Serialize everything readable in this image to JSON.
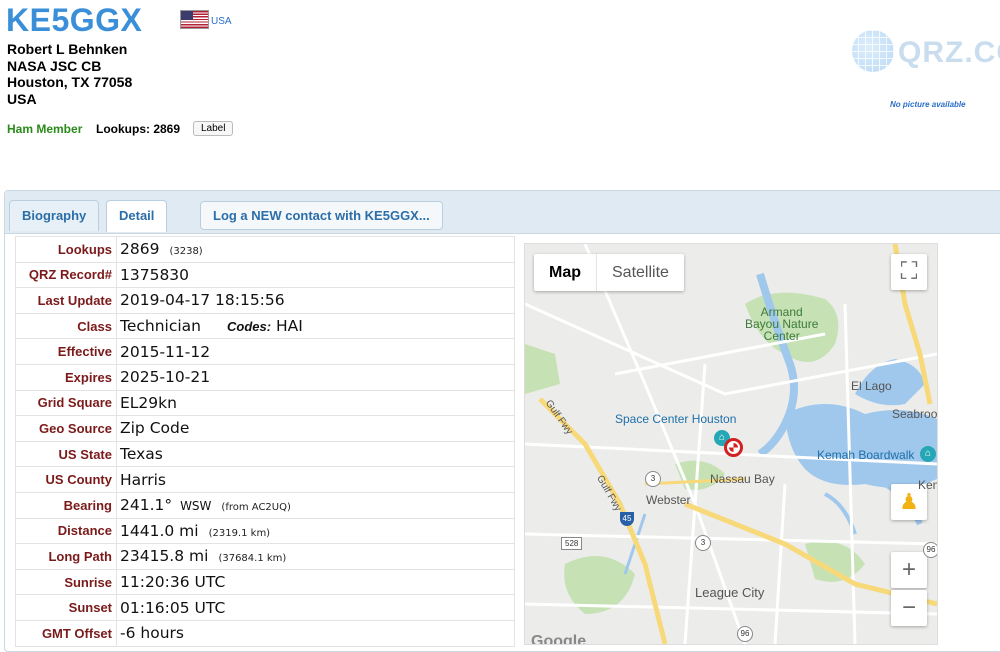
{
  "header": {
    "callsign": "KE5GGX",
    "country_label": "USA",
    "address": {
      "name": "Robert L Behnken",
      "line2": "NASA JSC CB",
      "line3": "Houston, TX 77058",
      "line4": "USA"
    },
    "member_status": "Ham Member",
    "lookups_text": "Lookups: 2869",
    "label_button": "Label",
    "logo_text": "QRZ.COM",
    "no_picture": "No picture available"
  },
  "tabs": {
    "biography": "Biography",
    "detail": "Detail",
    "log_contact": "Log a NEW contact with KE5GGX..."
  },
  "detail": {
    "lookups": {
      "key": "Lookups",
      "value": "2869",
      "extra": "(3238)"
    },
    "record": {
      "key": "QRZ Record#",
      "value": "1375830"
    },
    "last_update": {
      "key": "Last Update",
      "value": "2019-04-17 18:15:56"
    },
    "class": {
      "key": "Class",
      "value": "Technician",
      "codes_label": "Codes:",
      "codes": "HAI"
    },
    "effective": {
      "key": "Effective",
      "value": "2015-11-12"
    },
    "expires": {
      "key": "Expires",
      "value": "2025-10-21"
    },
    "grid": {
      "key": "Grid Square",
      "value": "EL29kn"
    },
    "geo": {
      "key": "Geo Source",
      "value": "Zip Code"
    },
    "state": {
      "key": "US State",
      "value": "Texas"
    },
    "county": {
      "key": "US County",
      "value": "Harris"
    },
    "bearing": {
      "key": "Bearing",
      "value": "241.1°",
      "dir": "WSW",
      "extra": "(from AC2UQ)"
    },
    "distance": {
      "key": "Distance",
      "value": "1441.0 mi",
      "extra": "(2319.1 km)"
    },
    "long_path": {
      "key": "Long Path",
      "value": "23415.8 mi",
      "extra": "(37684.1 km)"
    },
    "sunrise": {
      "key": "Sunrise",
      "value": "11:20:36 UTC"
    },
    "sunset": {
      "key": "Sunset",
      "value": "01:16:05 UTC"
    },
    "gmt_offset": {
      "key": "GMT Offset",
      "value": "-6 hours"
    }
  },
  "map": {
    "type_map": "Map",
    "type_satellite": "Satellite",
    "labels": {
      "armand": "Armand\nBayou Nature\nCenter",
      "el_lago": "El Lago",
      "seabrook": "Seabrool",
      "space_center": "Space Center Houston",
      "kemah_boardwalk": "Kemah Boardwalk",
      "kemah": "Kema",
      "nassau_bay": "Nassau Bay",
      "webster": "Webster",
      "league_city": "League City",
      "gulf_fwy_1": "Gulf Fwy",
      "gulf_fwy_2": "Gulf Fwy",
      "google": "Google"
    },
    "shields": {
      "r3a": "3",
      "r3b": "3",
      "i45": "45",
      "r528": "528",
      "r96": "96",
      "r96b": "96"
    },
    "zoom_in": "+",
    "zoom_out": "−",
    "colors": {
      "water": "#9fc8ec",
      "park": "#c6e2b5",
      "road": "#ffffff",
      "highway": "#f7d97a",
      "land": "#ececea"
    }
  }
}
